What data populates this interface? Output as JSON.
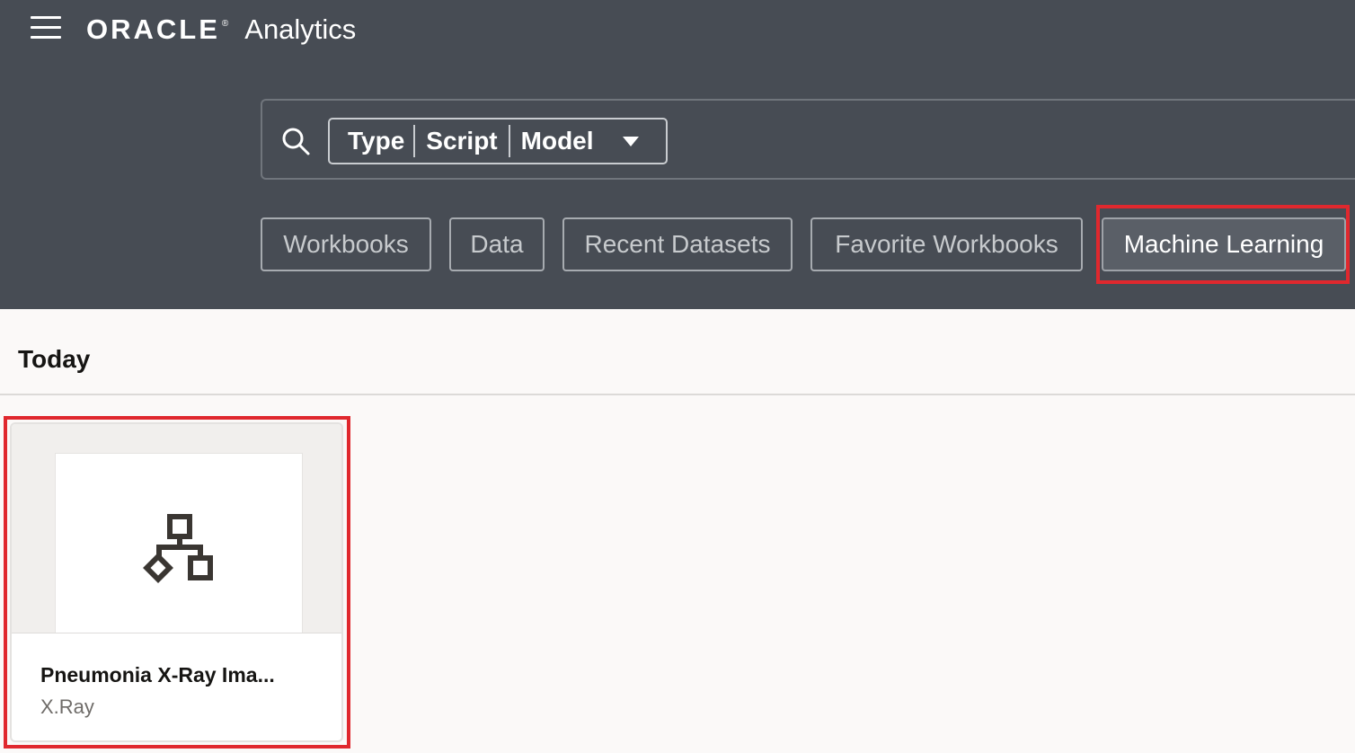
{
  "app": {
    "brand_logo": "ORACLE",
    "brand_registered": "®",
    "product_name": "Analytics"
  },
  "search": {
    "chip_parts": [
      "Type",
      "Script",
      "Model"
    ]
  },
  "filters": [
    {
      "label": "Workbooks",
      "active": false
    },
    {
      "label": "Data",
      "active": false
    },
    {
      "label": "Recent Datasets",
      "active": false
    },
    {
      "label": "Favorite Workbooks",
      "active": false
    },
    {
      "label": "Machine Learning",
      "active": true
    }
  ],
  "section": {
    "title": "Today"
  },
  "cards": [
    {
      "title": "Pneumonia X-Ray Ima...",
      "subtitle": "X.Ray",
      "icon": "model-hierarchy-icon"
    }
  ],
  "colors": {
    "header_bg": "#474c54",
    "page_bg": "#fbf9f8",
    "highlight": "#e0282e"
  }
}
